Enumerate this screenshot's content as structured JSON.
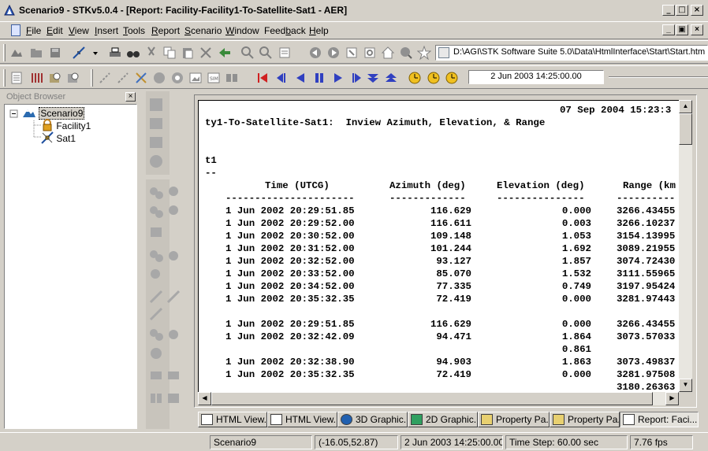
{
  "window": {
    "title": "Scenario9 - STKv5.0.4 - [Report:  Facility-Facility1-To-Satellite-Sat1 - AER]",
    "minimize": "_",
    "maximize": "□",
    "close": "×"
  },
  "menu": {
    "items": [
      {
        "label": "File",
        "accel": "F",
        "rest": "ile"
      },
      {
        "label": "Edit",
        "accel": "E",
        "rest": "dit"
      },
      {
        "label": "View",
        "accel": "V",
        "rest": "iew"
      },
      {
        "label": "Insert",
        "accel": "I",
        "rest": "nsert"
      },
      {
        "label": "Tools",
        "accel": "T",
        "rest": "ools"
      },
      {
        "label": "Report",
        "accel": "R",
        "rest": "eport"
      },
      {
        "label": "Scenario",
        "accel": "S",
        "rest": "cenario"
      },
      {
        "label": "Window",
        "accel": "W",
        "rest": "indow"
      },
      {
        "label": "Feedback",
        "accel": "b",
        "pre": "Feed",
        "rest": "ack"
      },
      {
        "label": "Help",
        "accel": "H",
        "rest": "elp"
      }
    ],
    "mdi_min": "_",
    "mdi_restore": "▣",
    "mdi_close": "×"
  },
  "address": {
    "path": "D:\\AGI\\STK Software Suite 5.0\\Data\\HtmlInterface\\Start\\Start.htm"
  },
  "animation": {
    "current_time": "2 Jun 2003 14:25:00.00"
  },
  "object_browser": {
    "title": "Object Browser",
    "close": "×",
    "tree": [
      {
        "label": "Scenario9",
        "icon": "scenario-icon",
        "level": 0,
        "selected": true
      },
      {
        "label": "Facility1",
        "icon": "facility-icon",
        "level": 1,
        "selected": false
      },
      {
        "label": "Sat1",
        "icon": "satellite-icon",
        "level": 1,
        "selected": false
      }
    ]
  },
  "report": {
    "date": "07 Sep 2004 15:23:3",
    "heading": "ty1-To-Satellite-Sat1:  Inview Azimuth, Elevation, & Range",
    "section_label": "t1",
    "section_rule": "--",
    "columns": [
      "Time (UTCG)",
      "Azimuth (deg)",
      "Elevation (deg)",
      "Range (km"
    ],
    "column_rules": [
      "----------------------",
      "-------------",
      "---------------",
      "----------"
    ],
    "rows": [
      {
        "time": "1 Jun 2002 20:29:51.85",
        "az": "116.629",
        "el": "0.000",
        "range": "3266.43455"
      },
      {
        "time": "1 Jun 2002 20:29:52.00",
        "az": "116.611",
        "el": "0.003",
        "range": "3266.10237"
      },
      {
        "time": "1 Jun 2002 20:30:52.00",
        "az": "109.148",
        "el": "1.053",
        "range": "3154.13995"
      },
      {
        "time": "1 Jun 2002 20:31:52.00",
        "az": "101.244",
        "el": "1.692",
        "range": "3089.21955"
      },
      {
        "time": "1 Jun 2002 20:32:52.00",
        "az": "93.127",
        "el": "1.857",
        "range": "3074.72430"
      },
      {
        "time": "1 Jun 2002 20:33:52.00",
        "az": "85.070",
        "el": "1.532",
        "range": "3111.55965"
      },
      {
        "time": "1 Jun 2002 20:34:52.00",
        "az": "77.335",
        "el": "0.749",
        "range": "3197.95424"
      },
      {
        "time": "1 Jun 2002 20:35:32.35",
        "az": "72.419",
        "el": "0.000",
        "range": "3281.97443"
      }
    ],
    "summary_rows": [
      {
        "time": "1 Jun 2002 20:29:51.85",
        "az": "116.629",
        "el": "0.000",
        "range": "3266.43455"
      },
      {
        "time": "1 Jun 2002 20:32:42.09",
        "az": "94.471",
        "el": "1.864",
        "range": "3073.57033"
      },
      {
        "time": "",
        "az": "",
        "el": "0.861",
        "range": ""
      },
      {
        "time": "1 Jun 2002 20:32:38.90",
        "az": "94.903",
        "el": "1.863",
        "range": "3073.49837"
      },
      {
        "time": "1 Jun 2002 20:35:32.35",
        "az": "72.419",
        "el": "0.000",
        "range": "3281.97508"
      },
      {
        "time": "",
        "az": "",
        "el": "",
        "range": "3180.26363"
      }
    ]
  },
  "window_tabs": [
    {
      "label": "HTML View...",
      "icon": "html-view-icon",
      "active": false
    },
    {
      "label": "HTML View...",
      "icon": "html-view-icon",
      "active": false
    },
    {
      "label": "3D Graphic...",
      "icon": "globe-icon",
      "active": false
    },
    {
      "label": "2D Graphic...",
      "icon": "map-icon",
      "active": false
    },
    {
      "label": "Property Pa...",
      "icon": "property-page-icon",
      "active": false
    },
    {
      "label": "Property Pa...",
      "icon": "property-page-icon",
      "active": false
    },
    {
      "label": "Report:  Faci...",
      "icon": "report-icon",
      "active": true
    }
  ],
  "status": {
    "scenario": "Scenario9",
    "cursor_latlon": "(-16.05,52.87)",
    "time": "2 Jun 2003 14:25:00.00",
    "time_step": "Time Step: 60.00 sec",
    "fps": "7.76 fps"
  }
}
